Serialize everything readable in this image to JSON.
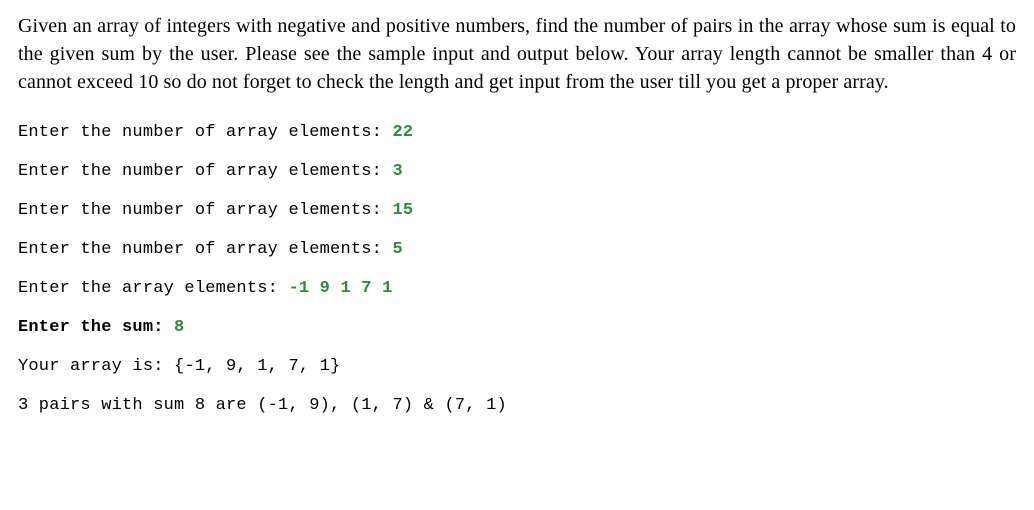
{
  "problem": {
    "description": "Given an array of integers with negative and positive numbers, find the number of pairs in the array whose sum is equal to the given sum by the user. Please see the sample input and output below. Your array length cannot be smaller than 4 or cannot exceed 10 so do not forget to check the length and get input from the user till you get a proper array."
  },
  "terminal": {
    "prompt1": "Enter the number of array elements: ",
    "input1": "22",
    "prompt2": "Enter the number of array elements: ",
    "input2": "3",
    "prompt3": "Enter the number of array elements: ",
    "input3": "15",
    "prompt4": "Enter the number of array elements: ",
    "input4": "5",
    "prompt5": "Enter the array elements: ",
    "input5": "-1 9 1 7 1",
    "prompt6_a": "Enter the sum:",
    "prompt6_b": " ",
    "input6": "8",
    "output1": "Your array is: {-1, 9, 1, 7, 1}",
    "output2": "3 pairs with sum 8 are (-1, 9), (1, 7) & (7, 1)"
  }
}
